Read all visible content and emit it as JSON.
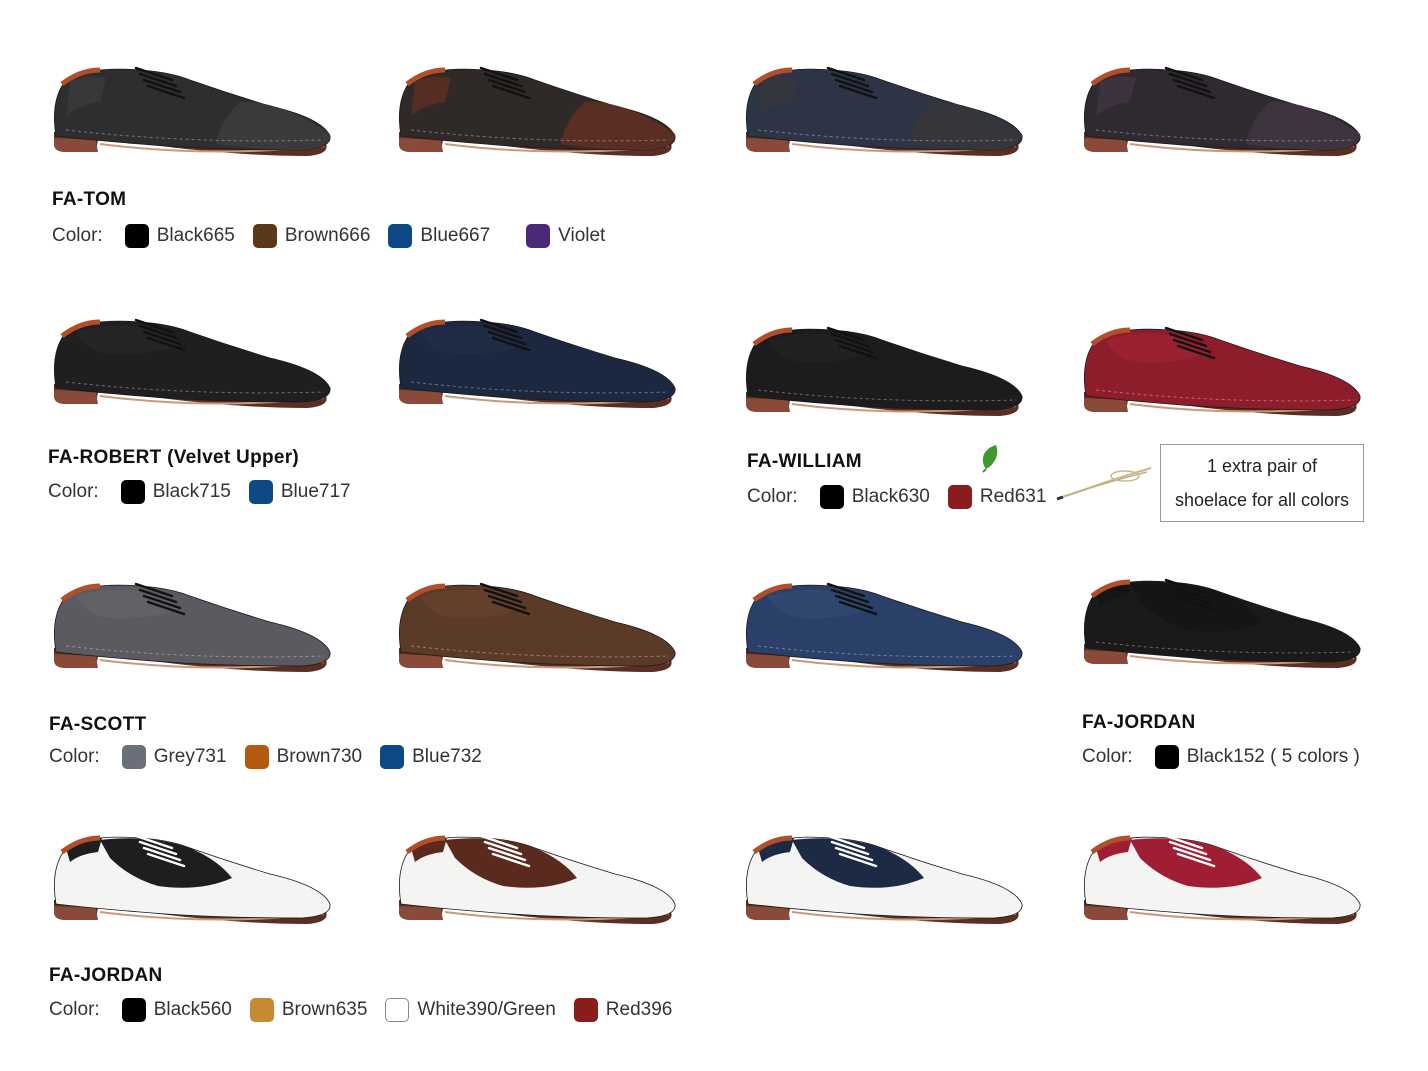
{
  "labels": {
    "color": "Color:"
  },
  "groups": [
    {
      "title": "FA-TOM",
      "colors": [
        {
          "name": "Black665",
          "hex": "#000000"
        },
        {
          "name": "Brown666",
          "hex": "#5a3818"
        },
        {
          "name": "Blue667",
          "hex": "#0d4a85"
        },
        {
          "name": "Violet",
          "hex": "#4a2a78"
        }
      ]
    },
    {
      "title": "FA-ROBERT (Velvet Upper)",
      "colors": [
        {
          "name": "Black715",
          "hex": "#000000"
        },
        {
          "name": "Blue717",
          "hex": "#0d4a85"
        }
      ]
    },
    {
      "title": "FA-WILLIAM",
      "colors": [
        {
          "name": "Black630",
          "hex": "#000000"
        },
        {
          "name": "Red631",
          "hex": "#8a1c1c"
        }
      ]
    },
    {
      "title": "FA-SCOTT",
      "colors": [
        {
          "name": "Grey731",
          "hex": "#6a6f7a"
        },
        {
          "name": "Brown730",
          "hex": "#b35a0e"
        },
        {
          "name": "Blue732",
          "hex": "#0d4a85"
        }
      ]
    },
    {
      "title": "FA-JORDAN",
      "colors": [
        {
          "name": "Black152 ( 5 colors )",
          "hex": "#000000"
        }
      ]
    },
    {
      "title": "FA-JORDAN",
      "colors": [
        {
          "name": "Black560",
          "hex": "#000000"
        },
        {
          "name": "Brown635",
          "hex": "#c68a35"
        },
        {
          "name": "White390/Green",
          "hex": "#ffffff"
        },
        {
          "name": "Red396",
          "hex": "#8a1c1c"
        }
      ]
    }
  ],
  "shoelace_note": {
    "line1": "1 extra pair of",
    "line2": "shoelace for all colors"
  },
  "icons": [
    "leaf-icon",
    "shoelace-icon"
  ],
  "shoes": [
    {
      "style": "wingtip",
      "upper": "#2e2e30",
      "toe": "#3a3a3c"
    },
    {
      "style": "wingtip",
      "upper": "#2f2a28",
      "toe": "#5a2e22"
    },
    {
      "style": "wingtip",
      "upper": "#2c3446",
      "toe": "#34363c"
    },
    {
      "style": "wingtip",
      "upper": "#2e2a30",
      "toe": "#3e3440"
    },
    {
      "style": "oxford",
      "upper": "#1f1f22",
      "toe": "#262628"
    },
    {
      "style": "oxford",
      "upper": "#1c2840",
      "toe": "#202c44"
    },
    {
      "style": "derby",
      "upper": "#1c1c1e",
      "toe": "#222224"
    },
    {
      "style": "derby",
      "upper": "#8e1d2c",
      "toe": "#9a2232"
    },
    {
      "style": "oxford",
      "upper": "#5a5a60",
      "toe": "#626268"
    },
    {
      "style": "oxford",
      "upper": "#5c3a28",
      "toe": "#64402c"
    },
    {
      "style": "oxford",
      "upper": "#2a4068",
      "toe": "#304870"
    },
    {
      "style": "saddle-suede",
      "upper": "#1a1a1a",
      "toe": "#151515"
    },
    {
      "style": "saddle",
      "upper": "#f4f4f2",
      "toe": "#1e1e1e"
    },
    {
      "style": "saddle",
      "upper": "#f4f4f2",
      "toe": "#5a2a1e"
    },
    {
      "style": "saddle",
      "upper": "#f4f4f2",
      "toe": "#1c2a44"
    },
    {
      "style": "saddle",
      "upper": "#f4f4f2",
      "toe": "#a01e34"
    }
  ]
}
